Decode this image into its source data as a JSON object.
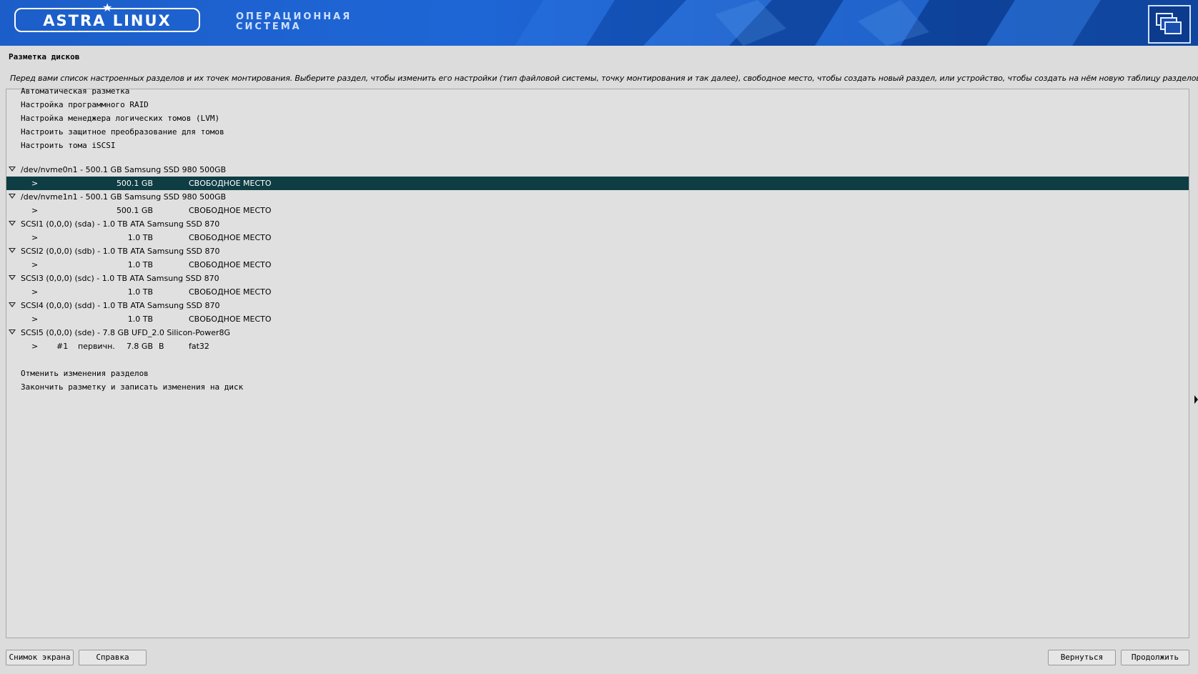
{
  "banner": {
    "logo_text": "ASTRA LINUX",
    "os_title_line1": "ОПЕРАЦИОННАЯ",
    "os_title_line2": "СИСТЕМА",
    "corner_icon": "windows-icon"
  },
  "page": {
    "title": "Разметка дисков",
    "description": "Перед вами список настроенных разделов и их точек монтирования. Выберите раздел, чтобы изменить его настройки (тип файловой системы, точку монтирования и так далее), свободное место, чтобы создать новый раздел, или устройство, чтобы создать на нём новую таблицу разделов."
  },
  "menu": {
    "top_items": [
      "Автоматическая разметка",
      "Настройка программного RAID",
      "Настройка менеджера логических томов (LVM)",
      "Настроить защитное преобразование для томов",
      "Настроить тома iSCSI"
    ],
    "devices": [
      {
        "name": "/dev/nvme0n1 - 500.1 GB Samsung SSD 980 500GB",
        "size": "500.1 GB",
        "fs": "СВОБОДНОЕ МЕСТО"
      },
      {
        "name": "/dev/nvme1n1 - 500.1 GB Samsung SSD 980 500GB",
        "size": "500.1 GB",
        "fs": "СВОБОДНОЕ МЕСТО"
      },
      {
        "name": "SCSI1 (0,0,0) (sda) - 1.0 TB ATA Samsung SSD 870",
        "size": "1.0 TB",
        "fs": "СВОБОДНОЕ МЕСТО"
      },
      {
        "name": "SCSI2 (0,0,0) (sdb) - 1.0 TB ATA Samsung SSD 870",
        "size": "1.0 TB",
        "fs": "СВОБОДНОЕ МЕСТО"
      },
      {
        "name": "SCSI3 (0,0,0) (sdc) - 1.0 TB ATA Samsung SSD 870",
        "size": "1.0 TB",
        "fs": "СВОБОДНОЕ МЕСТО"
      },
      {
        "name": "SCSI4 (0,0,0) (sdd) - 1.0 TB ATA Samsung SSD 870",
        "size": "1.0 TB",
        "fs": "СВОБОДНОЕ МЕСТО"
      }
    ],
    "usb_device": {
      "name": "SCSI5 (0,0,0) (sde) - 7.8 GB UFD_2.0 Silicon-Power8G",
      "partition_number": "#1",
      "partition_type": "первичн.",
      "size": "7.8 GB",
      "flag": "B",
      "fs": "fat32"
    },
    "arrow": ">",
    "bottom_items": [
      "Отменить изменения разделов",
      "Закончить разметку и записать изменения на диск"
    ]
  },
  "buttons": {
    "screenshot": "Снимок экрана",
    "help": "Справка",
    "back": "Вернуться",
    "continue": "Продолжить"
  },
  "colors": {
    "selected_row": "#0f3d44",
    "banner": "#1e66d6"
  }
}
